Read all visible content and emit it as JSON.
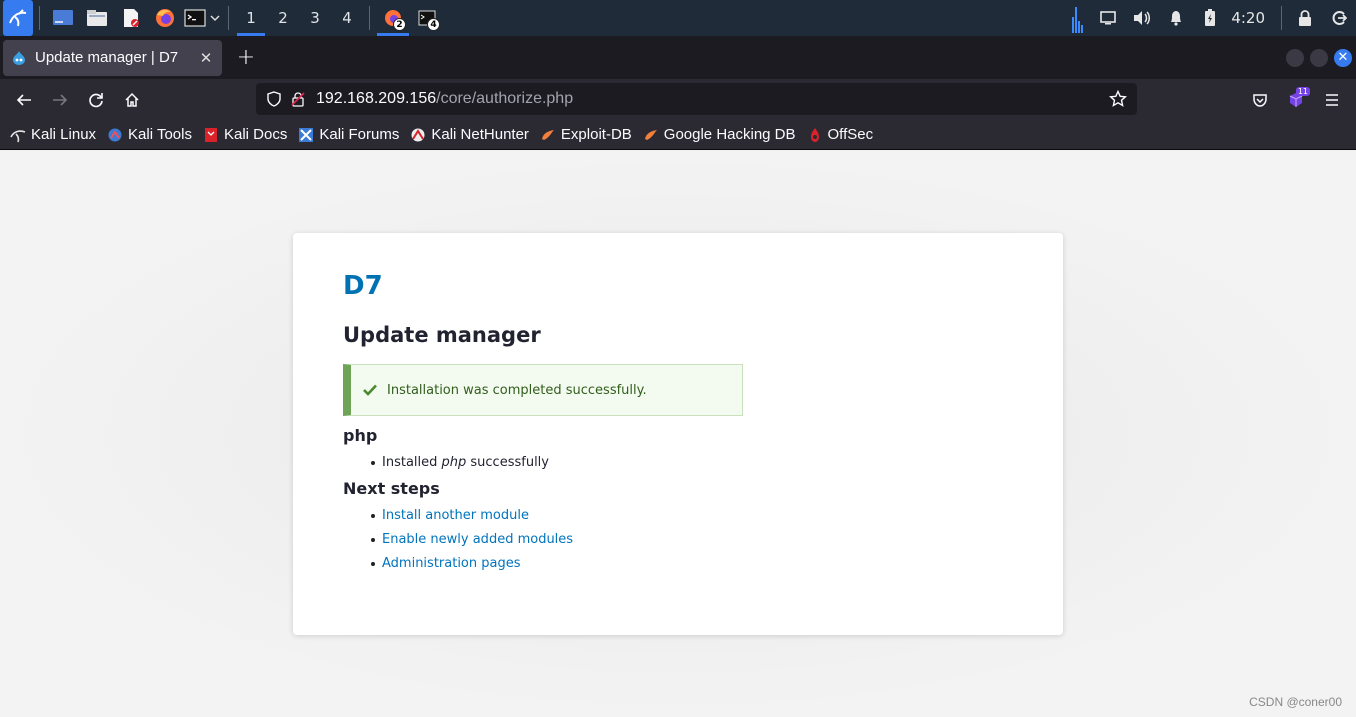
{
  "panel": {
    "workspaces": [
      "1",
      "2",
      "3",
      "4"
    ],
    "active_workspace": "1",
    "task_badges": [
      "2",
      "4"
    ],
    "clock": "4:20"
  },
  "browser": {
    "tab_title": "Update manager | D7",
    "new_tab_label": "+",
    "url_host": "192.168.209.156",
    "url_path": "/core/authorize.php",
    "extension_badge": "11",
    "bookmarks": [
      {
        "label": "Kali Linux",
        "icon": "kali-dragon-icon"
      },
      {
        "label": "Kali Tools",
        "icon": "kali-tools-icon"
      },
      {
        "label": "Kali Docs",
        "icon": "kali-docs-icon"
      },
      {
        "label": "Kali Forums",
        "icon": "kali-forums-icon"
      },
      {
        "label": "Kali NetHunter",
        "icon": "nethunter-icon"
      },
      {
        "label": "Exploit-DB",
        "icon": "exploit-db-icon"
      },
      {
        "label": "Google Hacking DB",
        "icon": "ghdb-icon"
      },
      {
        "label": "OffSec",
        "icon": "offsec-icon"
      }
    ]
  },
  "page": {
    "site_name": "D7",
    "title": "Update manager",
    "status_message": "Installation was completed successfully.",
    "module_heading": "php",
    "module_result": {
      "prefix": "Installed ",
      "module": "php",
      "suffix": " successfully"
    },
    "next_steps_heading": "Next steps",
    "next_steps": [
      "Install another module",
      "Enable newly added modules",
      "Administration pages"
    ]
  },
  "watermark": "CSDN @coner00",
  "colors": {
    "accent": "#367bf0",
    "drupal_link": "#0074bd",
    "success_border": "#6fa356",
    "success_bg": "#f3faef"
  }
}
